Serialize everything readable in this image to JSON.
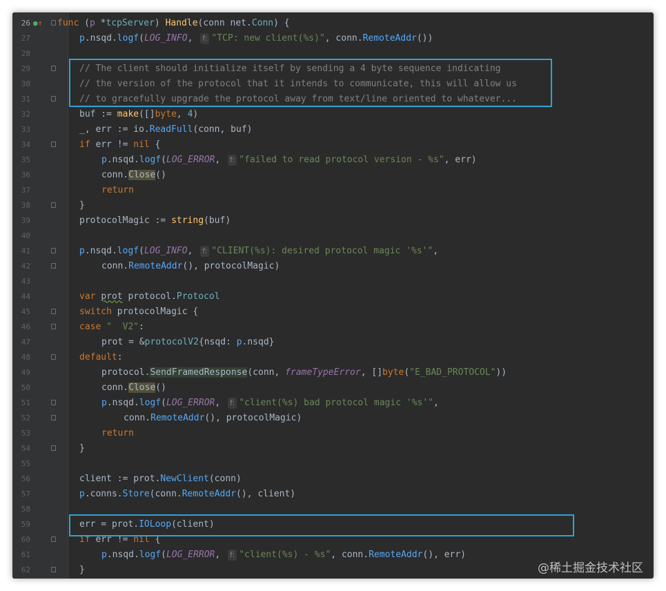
{
  "editor": {
    "lines": [
      {
        "n": "26",
        "current": true,
        "fold": true,
        "icons": true,
        "indent": 0,
        "tokens": [
          [
            "kw",
            "func "
          ],
          [
            "plain",
            "("
          ],
          [
            "pp",
            "p"
          ],
          [
            "plain",
            " *"
          ],
          [
            "typ",
            "tcpServer"
          ],
          [
            "plain",
            ") "
          ],
          [
            "fn",
            "Handle"
          ],
          [
            "plain",
            "(conn net."
          ],
          [
            "typ",
            "Conn"
          ],
          [
            "plain",
            ") {"
          ]
        ]
      },
      {
        "n": "27",
        "indent": 1,
        "tokens": [
          [
            "rcv",
            "p"
          ],
          [
            "plain",
            ".nsqd."
          ],
          [
            "mth",
            "logf"
          ],
          [
            "plain",
            "("
          ],
          [
            "con",
            "LOG_INFO"
          ],
          [
            "plain",
            ", "
          ],
          [
            "hint",
            "f:"
          ],
          [
            "str",
            "\"TCP: new client(%s)\""
          ],
          [
            "plain",
            ", conn."
          ],
          [
            "mth",
            "RemoteAddr"
          ],
          [
            "plain",
            "())"
          ]
        ]
      },
      {
        "n": "28",
        "indent": 0,
        "tokens": []
      },
      {
        "n": "29",
        "fold": true,
        "indent": 1,
        "tokens": [
          [
            "cmt",
            "// The client should initialize itself by sending a 4 byte sequence indicating"
          ]
        ]
      },
      {
        "n": "30",
        "indent": 1,
        "tokens": [
          [
            "cmt",
            "// the version of the protocol that it intends to communicate, this will allow us"
          ]
        ]
      },
      {
        "n": "31",
        "fold": true,
        "indent": 1,
        "tokens": [
          [
            "cmt",
            "// to gracefully upgrade the protocol away from text/line oriented to whatever..."
          ]
        ]
      },
      {
        "n": "32",
        "indent": 1,
        "tokens": [
          [
            "plain",
            "buf := "
          ],
          [
            "fn",
            "make"
          ],
          [
            "plain",
            "([]"
          ],
          [
            "kw",
            "byte"
          ],
          [
            "plain",
            ", "
          ],
          [
            "typ",
            "4"
          ],
          [
            "plain",
            ")"
          ]
        ]
      },
      {
        "n": "33",
        "indent": 1,
        "tokens": [
          [
            "plain",
            "_, err := io."
          ],
          [
            "mth",
            "ReadFull"
          ],
          [
            "plain",
            "(conn, buf)"
          ]
        ]
      },
      {
        "n": "34",
        "fold": true,
        "indent": 1,
        "tokens": [
          [
            "kw",
            "if "
          ],
          [
            "plain",
            "err != "
          ],
          [
            "kw",
            "nil"
          ],
          [
            "plain",
            " {"
          ]
        ]
      },
      {
        "n": "35",
        "indent": 2,
        "tokens": [
          [
            "rcv",
            "p"
          ],
          [
            "plain",
            ".nsqd."
          ],
          [
            "mth",
            "logf"
          ],
          [
            "plain",
            "("
          ],
          [
            "con",
            "LOG_ERROR"
          ],
          [
            "plain",
            ", "
          ],
          [
            "hint",
            "f:"
          ],
          [
            "str",
            "\"failed to read protocol version - %s\""
          ],
          [
            "plain",
            ", err)"
          ]
        ]
      },
      {
        "n": "36",
        "indent": 2,
        "tokens": [
          [
            "plain",
            "conn."
          ],
          [
            "hl2",
            "Close"
          ],
          [
            "plain",
            "()"
          ]
        ]
      },
      {
        "n": "37",
        "indent": 2,
        "tokens": [
          [
            "kw",
            "return"
          ]
        ]
      },
      {
        "n": "38",
        "fold": true,
        "indent": 1,
        "tokens": [
          [
            "plain",
            "}"
          ]
        ]
      },
      {
        "n": "39",
        "indent": 1,
        "tokens": [
          [
            "plain",
            "protocolMagic := "
          ],
          [
            "fn",
            "string"
          ],
          [
            "plain",
            "(buf)"
          ]
        ]
      },
      {
        "n": "40",
        "indent": 0,
        "tokens": []
      },
      {
        "n": "41",
        "fold": true,
        "indent": 1,
        "tokens": [
          [
            "rcv",
            "p"
          ],
          [
            "plain",
            ".nsqd."
          ],
          [
            "mth",
            "logf"
          ],
          [
            "plain",
            "("
          ],
          [
            "con",
            "LOG_INFO"
          ],
          [
            "plain",
            ", "
          ],
          [
            "hint",
            "f:"
          ],
          [
            "str",
            "\"CLIENT(%s): desired protocol magic '%s'\""
          ],
          [
            "plain",
            ","
          ]
        ]
      },
      {
        "n": "42",
        "fold": true,
        "indent": 2,
        "tokens": [
          [
            "plain",
            "conn."
          ],
          [
            "mth",
            "RemoteAddr"
          ],
          [
            "plain",
            "(), protocolMagic)"
          ]
        ]
      },
      {
        "n": "43",
        "indent": 0,
        "tokens": []
      },
      {
        "n": "44",
        "indent": 1,
        "tokens": [
          [
            "kw",
            "var "
          ],
          [
            "squig",
            "prot"
          ],
          [
            "plain",
            " protocol."
          ],
          [
            "typ",
            "Protocol"
          ]
        ]
      },
      {
        "n": "45",
        "fold": true,
        "indent": 1,
        "tokens": [
          [
            "kw",
            "switch "
          ],
          [
            "plain",
            "protocolMagic {"
          ]
        ]
      },
      {
        "n": "46",
        "fold": true,
        "indent": 1,
        "tokens": [
          [
            "kw",
            "case "
          ],
          [
            "str",
            "\"  V2\""
          ],
          [
            "plain",
            ":"
          ]
        ]
      },
      {
        "n": "47",
        "indent": 2,
        "tokens": [
          [
            "plain",
            "prot = &"
          ],
          [
            "typ",
            "protocolV2"
          ],
          [
            "plain",
            "{nsqd: "
          ],
          [
            "rcv",
            "p"
          ],
          [
            "plain",
            ".nsqd}"
          ]
        ]
      },
      {
        "n": "48",
        "fold": true,
        "indent": 1,
        "tokens": [
          [
            "kw",
            "default"
          ],
          [
            "plain",
            ":"
          ]
        ]
      },
      {
        "n": "49",
        "indent": 2,
        "tokens": [
          [
            "plain",
            "protocol."
          ],
          [
            "hl",
            "SendFramedResponse"
          ],
          [
            "plain",
            "(conn, "
          ],
          [
            "con",
            "frameTypeError"
          ],
          [
            "plain",
            ", []"
          ],
          [
            "kw",
            "byte"
          ],
          [
            "plain",
            "("
          ],
          [
            "str",
            "\"E_BAD_PROTOCOL\""
          ],
          [
            "plain",
            "))"
          ]
        ]
      },
      {
        "n": "50",
        "indent": 2,
        "tokens": [
          [
            "plain",
            "conn."
          ],
          [
            "hl2",
            "Close"
          ],
          [
            "plain",
            "()"
          ]
        ]
      },
      {
        "n": "51",
        "fold": true,
        "indent": 2,
        "tokens": [
          [
            "rcv",
            "p"
          ],
          [
            "plain",
            ".nsqd."
          ],
          [
            "mth",
            "logf"
          ],
          [
            "plain",
            "("
          ],
          [
            "con",
            "LOG_ERROR"
          ],
          [
            "plain",
            ", "
          ],
          [
            "hint",
            "f:"
          ],
          [
            "str",
            "\"client(%s) bad protocol magic '%s'\""
          ],
          [
            "plain",
            ","
          ]
        ]
      },
      {
        "n": "52",
        "fold": true,
        "indent": 3,
        "tokens": [
          [
            "plain",
            "conn."
          ],
          [
            "mth",
            "RemoteAddr"
          ],
          [
            "plain",
            "(), protocolMagic)"
          ]
        ]
      },
      {
        "n": "53",
        "indent": 2,
        "tokens": [
          [
            "kw",
            "return"
          ]
        ]
      },
      {
        "n": "54",
        "fold": true,
        "indent": 1,
        "tokens": [
          [
            "plain",
            "}"
          ]
        ]
      },
      {
        "n": "55",
        "indent": 0,
        "tokens": []
      },
      {
        "n": "56",
        "indent": 1,
        "tokens": [
          [
            "plain",
            "client := prot."
          ],
          [
            "mth",
            "NewClient"
          ],
          [
            "plain",
            "(conn)"
          ]
        ]
      },
      {
        "n": "57",
        "indent": 1,
        "tokens": [
          [
            "rcv",
            "p"
          ],
          [
            "plain",
            ".conns."
          ],
          [
            "mth",
            "Store"
          ],
          [
            "plain",
            "(conn."
          ],
          [
            "mth",
            "RemoteAddr"
          ],
          [
            "plain",
            "(), client)"
          ]
        ]
      },
      {
        "n": "58",
        "indent": 0,
        "tokens": []
      },
      {
        "n": "59",
        "indent": 1,
        "tokens": [
          [
            "plain",
            "err = prot."
          ],
          [
            "mth",
            "IOLoop"
          ],
          [
            "plain",
            "(client)"
          ]
        ]
      },
      {
        "n": "60",
        "fold": true,
        "indent": 1,
        "tokens": [
          [
            "kw",
            "if "
          ],
          [
            "plain",
            "err != "
          ],
          [
            "kw",
            "nil"
          ],
          [
            "plain",
            " {"
          ]
        ]
      },
      {
        "n": "61",
        "indent": 2,
        "tokens": [
          [
            "rcv",
            "p"
          ],
          [
            "plain",
            ".nsqd."
          ],
          [
            "mth",
            "logf"
          ],
          [
            "plain",
            "("
          ],
          [
            "con",
            "LOG_ERROR"
          ],
          [
            "plain",
            ", "
          ],
          [
            "hint",
            "f:"
          ],
          [
            "str",
            "\"client(%s) - %s\""
          ],
          [
            "plain",
            ", conn."
          ],
          [
            "mth",
            "RemoteAddr"
          ],
          [
            "plain",
            "(), err)"
          ]
        ]
      },
      {
        "n": "62",
        "fold": true,
        "indent": 1,
        "tokens": [
          [
            "plain",
            "}"
          ]
        ]
      }
    ]
  },
  "watermark": "@稀土掘金技术社区",
  "colors": {
    "box_outline": "#2fa3d6",
    "editor_bg": "#2b2b2b",
    "gutter_bg": "#313335"
  }
}
